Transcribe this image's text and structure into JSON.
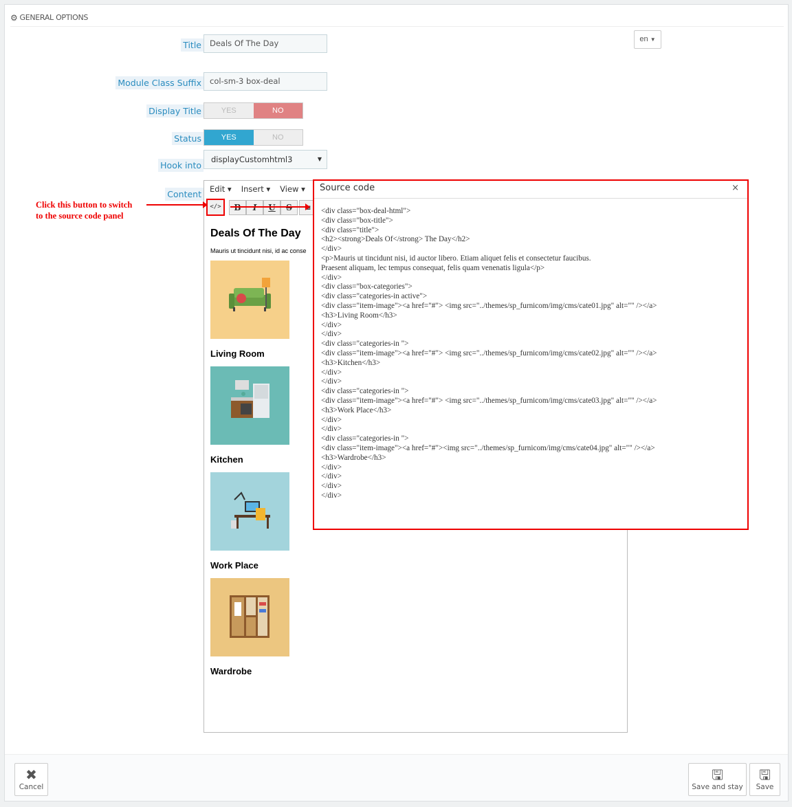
{
  "panel": {
    "heading": "GENERAL OPTIONS",
    "heading_icon": "cogs-icon"
  },
  "form": {
    "title_label": "Title",
    "title_value": "Deals Of The Day",
    "lang_value": "en",
    "suffix_label": "Module Class Suffix",
    "suffix_value": "col-sm-3 box-deal",
    "display_title_label": "Display Title",
    "display_title_yes": "YES",
    "display_title_no": "NO",
    "display_title_value": "NO",
    "status_label": "Status",
    "status_yes": "YES",
    "status_no": "NO",
    "status_value": "YES",
    "hook_label": "Hook into",
    "hook_value": "displayCustomhtml3",
    "content_label": "Content"
  },
  "editor": {
    "menu": [
      "Edit",
      "Insert",
      "View"
    ],
    "toolbar": {
      "source": "</>",
      "bold": "B",
      "italic": "I",
      "underline": "U",
      "strike": "S"
    },
    "heading": "Deals Of The Day",
    "paragraph": "Mauris ut tincidunt nisi, id ac consequat, felis quam vener",
    "categories": [
      {
        "title": "Living Room",
        "bg": "#f6d08a"
      },
      {
        "title": "Kitchen",
        "bg": "#6bbbb5"
      },
      {
        "title": "Work Place",
        "bg": "#a3d4dc"
      },
      {
        "title": "Wardrobe",
        "bg": "#ecc680"
      }
    ]
  },
  "annotation": {
    "line1": "Click this button to switch",
    "line2": "to the source code panel",
    "color": "#ee0000"
  },
  "source_modal": {
    "title": "Source code",
    "close": "×",
    "code": "<div class=\"box-deal-html\">\n<div class=\"box-title\">\n<div class=\"title\">\n<h2><strong>Deals Of</strong> The Day</h2>\n</div>\n<p>Mauris ut tincidunt nisi, id auctor libero. Etiam aliquet felis et consectetur faucibus.\nPraesent aliquam, lec tempus consequat, felis quam venenatis ligula</p>\n</div>\n<div class=\"box-categories\">\n<div class=\"categories-in active\">\n<div class=\"item-image\"><a href=\"#\"> <img src=\"../themes/sp_furnicom/img/cms/cate01.jpg\" alt=\"\" /></a>\n<h3>Living Room</h3>\n</div>\n</div>\n<div class=\"categories-in \">\n<div class=\"item-image\"><a href=\"#\"> <img src=\"../themes/sp_furnicom/img/cms/cate02.jpg\" alt=\"\" /></a>\n<h3>Kitchen</h3>\n</div>\n</div>\n<div class=\"categories-in \">\n<div class=\"item-image\"><a href=\"#\"> <img src=\"../themes/sp_furnicom/img/cms/cate03.jpg\" alt=\"\" /></a>\n<h3>Work Place</h3>\n</div>\n</div>\n<div class=\"categories-in \">\n<div class=\"item-image\"><a href=\"#\"><img src=\"../themes/sp_furnicom/img/cms/cate04.jpg\" alt=\"\" /></a>\n<h3>Wardrobe</h3>\n</div>\n</div>\n</div>\n</div>"
  },
  "footer": {
    "cancel": "Cancel",
    "save_stay": "Save and stay",
    "save": "Save"
  }
}
